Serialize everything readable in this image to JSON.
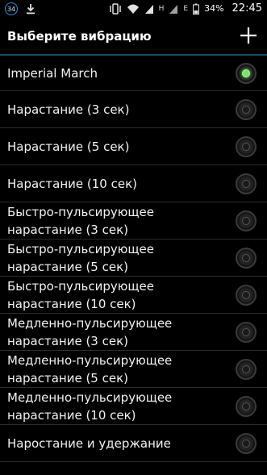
{
  "status_bar": {
    "notification_badge": "34",
    "network_h": "H",
    "network_e": "E",
    "battery": "34%",
    "time": "22:45"
  },
  "app_bar": {
    "title": "Выберите вибрацию",
    "add_icon": "plus-icon"
  },
  "list": {
    "selected_index": 0,
    "items": [
      {
        "label": "Imperial March"
      },
      {
        "label": "Нарастание (3 сек)"
      },
      {
        "label": "Нарастание (5 сек)"
      },
      {
        "label": "Нарастание (10 сек)"
      },
      {
        "label": "Быстро-пульсирующее нарастание (3 сек)"
      },
      {
        "label": "Быстро-пульсирующее нарастание (5 сек)"
      },
      {
        "label": "Быстро-пульсирующее нарастание (10 сек)"
      },
      {
        "label": "Медленно-пульсирующее нарастание (3 сек)"
      },
      {
        "label": "Медленно-пульсирующее нарастание (5 сек)"
      },
      {
        "label": "Медленно-пульсирующее нарастание (10 сек)"
      },
      {
        "label": "Наростание и удержание"
      }
    ]
  },
  "colors": {
    "accent": "#7be36b",
    "divider": "#1f4b6a"
  }
}
